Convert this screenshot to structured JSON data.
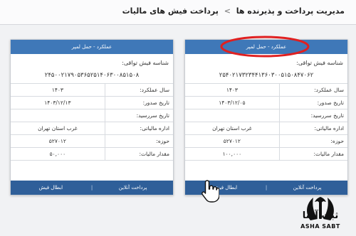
{
  "breadcrumb": {
    "parent": "مدیریت پرداخت و پذیرنده ها",
    "separator": ">",
    "current": "پرداخت فیش های مالیات"
  },
  "cards": {
    "right": {
      "header": "عملکرد - حمل لمپر",
      "id_label": "شناسه فیش تواقی:",
      "id_value": "۲۵۴۰۲۱۷۳۲۳۴۴۱۳۶۰۳۰۰۵۱۵۰۸۴۷۰۶۲",
      "rows": [
        {
          "label": "سال عملکرد:",
          "value": "۱۴۰۳"
        },
        {
          "label": "تاریخ صدور:",
          "value": "۱۴۰۳/۱۲/۰۵"
        },
        {
          "label": "تاریخ سررسید:",
          "value": ""
        },
        {
          "label": "اداره مالیاتی:",
          "value": "غرب استان تهران"
        },
        {
          "label": "حوزه:",
          "value": "۵۲۷۰۱۲"
        },
        {
          "label": "مقدار مالیات:",
          "value": "۱۰۰,۰۰۰"
        }
      ],
      "pay_label": "پرداخت آنلاین",
      "cancel_label": "ابطال فیش"
    },
    "left": {
      "header": "عملکرد - حمل لمپر",
      "id_label": "شناسه فیش تواقی:",
      "id_value": "۲۴۵۰۰۲۱۷۹۰۵۳۶۵۲۵۱۴۰۶۳۰۰۸۵۱۵۰۸",
      "rows": [
        {
          "label": "سال عملکرد:",
          "value": "۱۴۰۳"
        },
        {
          "label": "تاریخ صدور:",
          "value": "۱۴۰۳/۱۲/۱۳"
        },
        {
          "label": "تاریخ سررسید:",
          "value": ""
        },
        {
          "label": "اداره مالیاتی:",
          "value": "غرب استان تهران"
        },
        {
          "label": "حوزه:",
          "value": "۵۲۷۰۱۲"
        },
        {
          "label": "مقدار مالیات:",
          "value": "۵۰,۰۰۰"
        }
      ],
      "pay_label": "پرداخت آنلاین",
      "cancel_label": "ابطال فیش"
    }
  },
  "watermark": {
    "fa": "ثبت آشا",
    "en": "ASHA SABT"
  },
  "colors": {
    "card_header": "#3f78b8",
    "card_footer": "#2f5f99",
    "highlight": "#e02020"
  },
  "icons": {
    "cursor": "hand-pointer-icon",
    "logo": "asha-sabt-logo"
  }
}
